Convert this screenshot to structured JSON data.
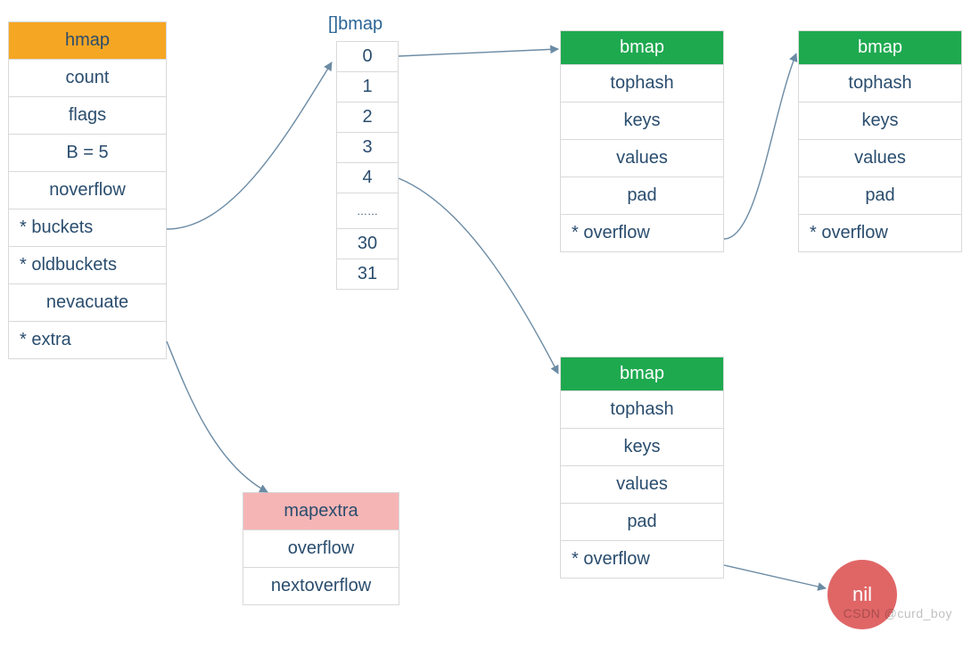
{
  "colors": {
    "orange": "#f5a623",
    "green": "#1ea94f",
    "pink": "#f5b5b5",
    "text": "#2a4d6e",
    "nil": "#e06666",
    "arrow": "#6b8ba4"
  },
  "hmap": {
    "header": "hmap",
    "fields": [
      "count",
      "flags",
      "B = 5",
      "noverflow",
      "* buckets",
      "* oldbuckets",
      "nevacuate",
      "* extra"
    ]
  },
  "array": {
    "label": "[]bmap",
    "cells": [
      "0",
      "1",
      "2",
      "3",
      "4",
      "……",
      "30",
      "31"
    ]
  },
  "bmap0": {
    "header": "bmap",
    "fields": [
      "tophash",
      "keys",
      "values",
      "pad",
      "* overflow"
    ]
  },
  "bmap_overflow": {
    "header": "bmap",
    "fields": [
      "tophash",
      "keys",
      "values",
      "pad",
      "* overflow"
    ]
  },
  "bmap4": {
    "header": "bmap",
    "fields": [
      "tophash",
      "keys",
      "values",
      "pad",
      "* overflow"
    ]
  },
  "mapextra": {
    "header": "mapextra",
    "fields": [
      "overflow",
      "nextoverflow"
    ]
  },
  "nil_label": "nil",
  "watermark": "CSDN @curd_boy"
}
